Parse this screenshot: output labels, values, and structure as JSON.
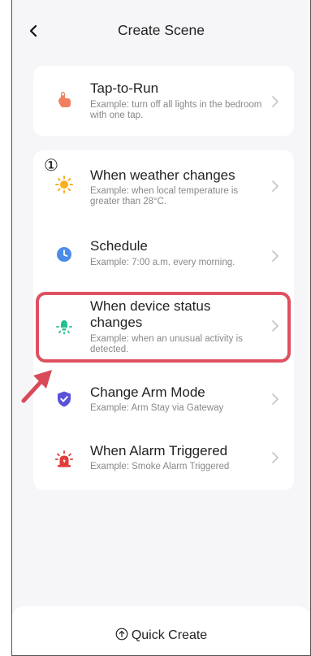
{
  "header": {
    "title": "Create Scene",
    "back_icon": "chevron-left-icon"
  },
  "card_manual": {
    "items": [
      {
        "title": "Tap-to-Run",
        "subtitle": "Example: turn off all lights in the bedroom with one tap.",
        "icon": "hand-tap-icon",
        "color": "#f08060"
      }
    ]
  },
  "card_auto": {
    "items": [
      {
        "title": "When weather changes",
        "subtitle": "Example: when local temperature is greater than 28°C.",
        "icon": "sun-icon",
        "color": "#f8b020"
      },
      {
        "title": "Schedule",
        "subtitle": "Example: 7:00 a.m. every morning.",
        "icon": "clock-icon",
        "color": "#4a8ce8"
      },
      {
        "title": "When device status changes",
        "subtitle": "Example: when an unusual activity is detected.",
        "icon": "device-bulb-icon",
        "color": "#22c090"
      },
      {
        "title": "Change Arm Mode",
        "subtitle": "Example: Arm Stay via Gateway",
        "icon": "shield-check-icon",
        "color": "#5a52d8"
      },
      {
        "title": "When Alarm Triggered",
        "subtitle": "Example: Smoke Alarm Triggered",
        "icon": "alarm-siren-icon",
        "color": "#e03c3c"
      }
    ]
  },
  "annotations": {
    "step_number": "①",
    "highlight_color": "#df5060",
    "arrow_color": "#d84a5a"
  },
  "bottom": {
    "quick_create_label": "Quick Create",
    "quick_create_icon": "circle-arrow-up-icon"
  }
}
